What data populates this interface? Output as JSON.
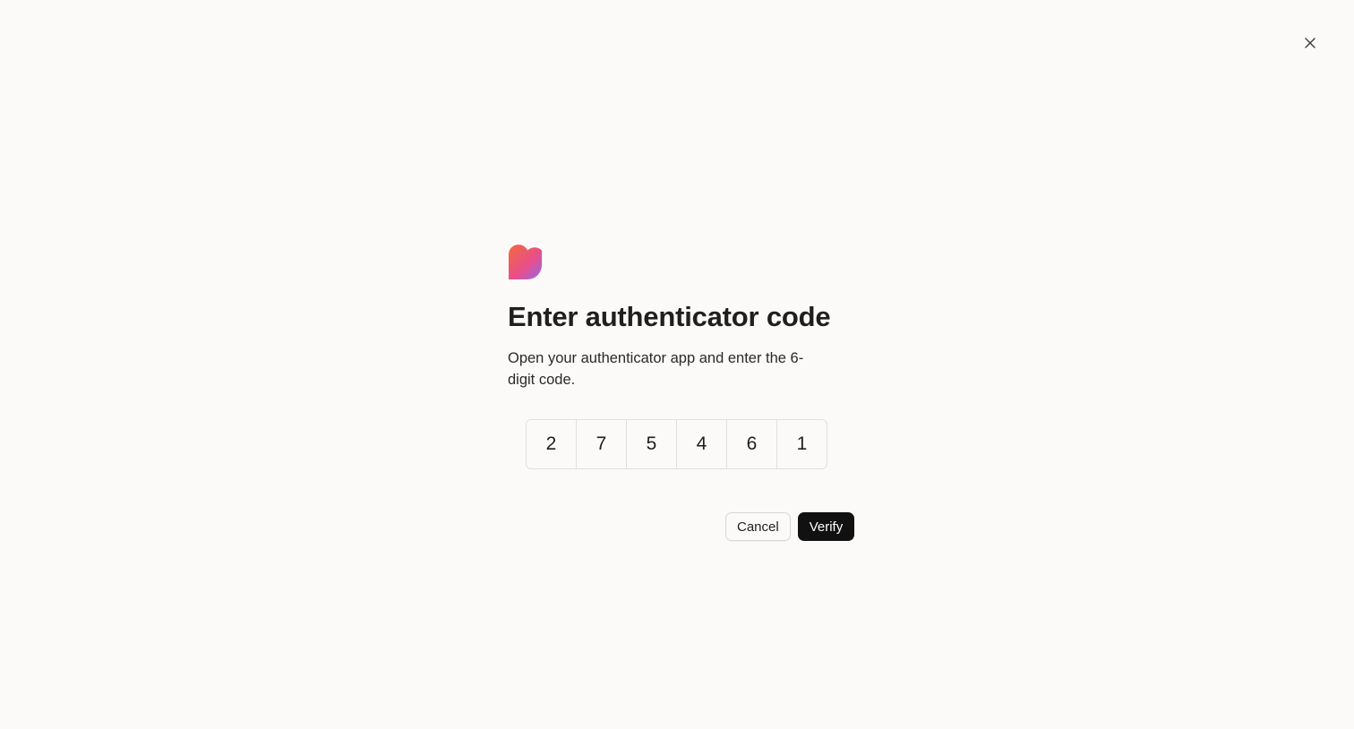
{
  "window": {
    "close_icon": "close-icon"
  },
  "brand": {
    "logo_icon": "brand-heart-logo",
    "gradient_colors": [
      "#f26a3d",
      "#e94e8a",
      "#8b6cf2"
    ]
  },
  "dialog": {
    "title": "Enter authenticator code",
    "description": "Open your authenticator app and enter the 6-digit code.",
    "code_digits": [
      "2",
      "7",
      "5",
      "4",
      "6",
      "1"
    ]
  },
  "actions": {
    "cancel_label": "Cancel",
    "verify_label": "Verify"
  },
  "colors": {
    "background": "#fbfaf8",
    "primary_button": "#111111",
    "border": "#e2e0dc"
  }
}
